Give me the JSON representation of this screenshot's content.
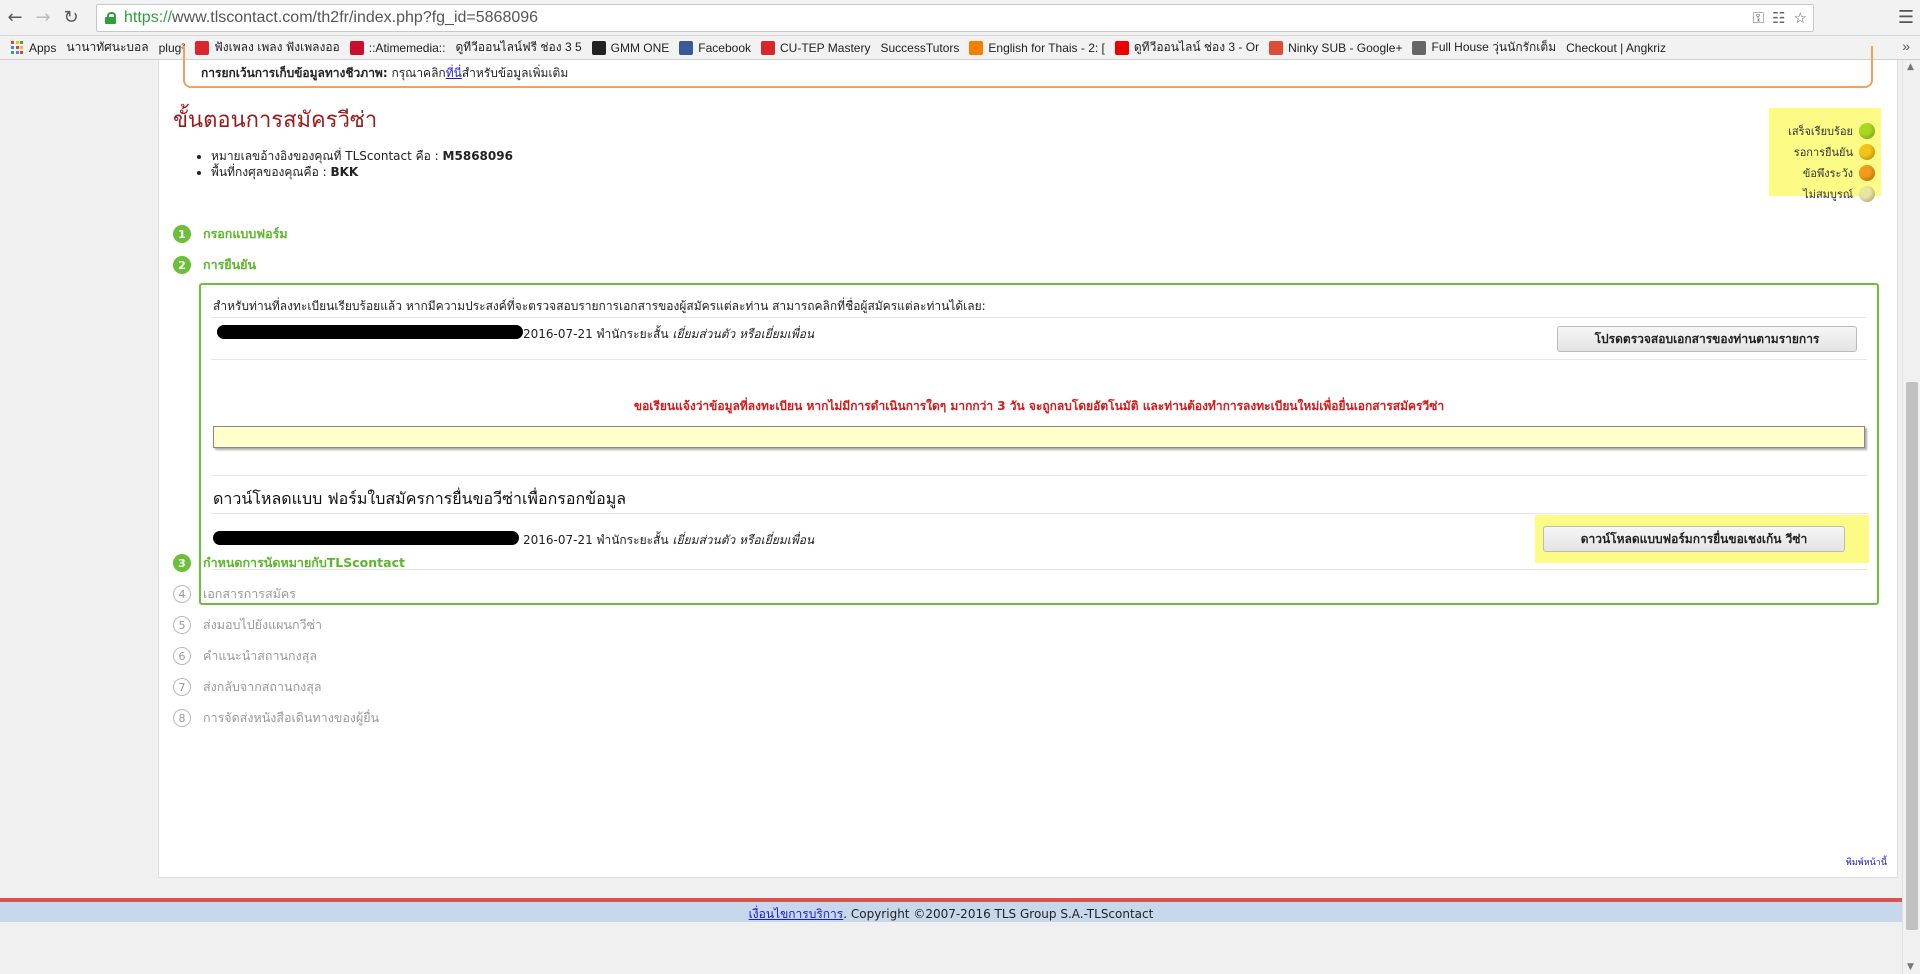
{
  "browser": {
    "url_scheme": "https://",
    "url_rest": "www.tlscontact.com/th2fr/index.php?fg_id=5868096",
    "bookmarks": [
      {
        "label": "Apps",
        "icon": "apps-icon"
      },
      {
        "label": "นานาทัศนะบอล",
        "icon": "page-icon"
      },
      {
        "label": "plug³",
        "icon": "page-icon"
      },
      {
        "label": "ฟังเพลง เพลง ฟังเพลงออ",
        "icon": "music-icon"
      },
      {
        "label": "::Atimemedia::",
        "icon": "atime-icon"
      },
      {
        "label": "ดูทีวีออนไลน์ฟรี ช่อง 3 5",
        "icon": "page-icon"
      },
      {
        "label": "GMM ONE",
        "icon": "gmm-icon"
      },
      {
        "label": "Facebook",
        "icon": "facebook-icon"
      },
      {
        "label": "CU-TEP Mastery",
        "icon": "cutep-icon"
      },
      {
        "label": "SuccessTutors",
        "icon": "page-icon"
      },
      {
        "label": "English for Thais - 2: [",
        "icon": "blogger-icon"
      },
      {
        "label": "ดูทีวีออนไลน์ ช่อง 3 - Or",
        "icon": "opera-icon"
      },
      {
        "label": "Ninky SUB - Google+",
        "icon": "googleplus-icon"
      },
      {
        "label": "Full House วุ่นนักรักเต็ม",
        "icon": "fullhouse-icon"
      },
      {
        "label": "Checkout | Angkriz",
        "icon": "page-icon"
      }
    ]
  },
  "notice": {
    "bold": "การยกเว้นการเก็บข้อมูลทางชีวภาพ:",
    "text1": " กรุณาคลิก",
    "link": "ที่นี่",
    "text2": "สำหรับข้อมูลเพิ่มเติม"
  },
  "title": "ขั้นตอนการสมัครวีซ่า",
  "refs": {
    "ref_label": "หมายเลขอ้างอิงของคุณที่ TLScontact คือ : ",
    "ref_value": "M5868096",
    "consulate_label": "พื้นที่กงศุลของคุณคือ : ",
    "consulate_value": "BKK"
  },
  "legend": [
    {
      "label": "เสร็จเรียบร้อย",
      "color": "#a8d820"
    },
    {
      "label": "รอการยืนยัน",
      "color": "#f5c21a"
    },
    {
      "label": "ข้อพึงระวัง",
      "color": "#f39a1a"
    },
    {
      "label": "ไม่สมบูรณ์",
      "color": "#e8e6a0"
    }
  ],
  "steps": [
    {
      "num": "1",
      "label": "กรอกแบบฟอร์ม",
      "status": "done"
    },
    {
      "num": "2",
      "label": "การยืนยัน",
      "status": "done"
    },
    {
      "num": "3",
      "label": "กำหนดการนัดหมายกับTLScontact",
      "status": "done"
    },
    {
      "num": "4",
      "label": "เอกสารการสมัคร",
      "status": "todo"
    },
    {
      "num": "5",
      "label": "ส่งมอบไปยังแผนกวีซ่า",
      "status": "todo"
    },
    {
      "num": "6",
      "label": "คำแนะนำสถานกงสุล",
      "status": "todo"
    },
    {
      "num": "7",
      "label": "ส่งกลับจากสถานกงสุล",
      "status": "todo"
    },
    {
      "num": "8",
      "label": "การจัดส่งหนังสือเดินทางของผู้ยื่น",
      "status": "todo"
    }
  ],
  "confirm": {
    "intro": "สำหรับท่านที่ลงทะเบียนเรียบร้อยแล้ว หากมีความประสงค์ที่จะตรวจสอบรายการเอกสารของผู้สมัครแต่ละท่าน สามารถคลิกที่ชื่อผู้สมัครแต่ละท่านได้เลย:",
    "row1_date": "2016-07-21",
    "row1_stay": " พำนักระยะสั้น ",
    "row1_purpose": "เยี่ยมส่วนตัว หรือเยี่ยมเพื่อน",
    "check_button": "โปรดตรวจสอบเอกสารของท่านตามรายการ",
    "warning": "ขอเรียนแจ้งว่าข้อมูลที่ลงทะเบียน หากไม่มีการดำเนินการใดๆ มากกว่า 3 วัน จะถูกลบโดยอัตโนมัติ และท่านต้องทำการลงทะเบียนใหม่เพื่อยื่นเอกสารสมัครวีซ่า",
    "download_title": "ดาวน์โหลดแบบ ฟอร์มใบสมัครการยื่นขอวีซ่าเพื่อกรอกข้อมูล",
    "row2_date": "2016-07-21",
    "row2_stay": " พำนักระยะสั้น ",
    "row2_purpose": "เยี่ยมส่วนตัว หรือเยี่ยมเพื่อน",
    "download_button": "ดาวน์โหลดแบบฟอร์มการยื่นขอเชงเก้น วีซ่า"
  },
  "print_link": "พิมพ์หน้านี้",
  "footer": {
    "link": "เงื่อนไขการบริการ",
    "text": ".  Copyright ©2007-2016 TLS Group S.A.-TLScontact"
  }
}
